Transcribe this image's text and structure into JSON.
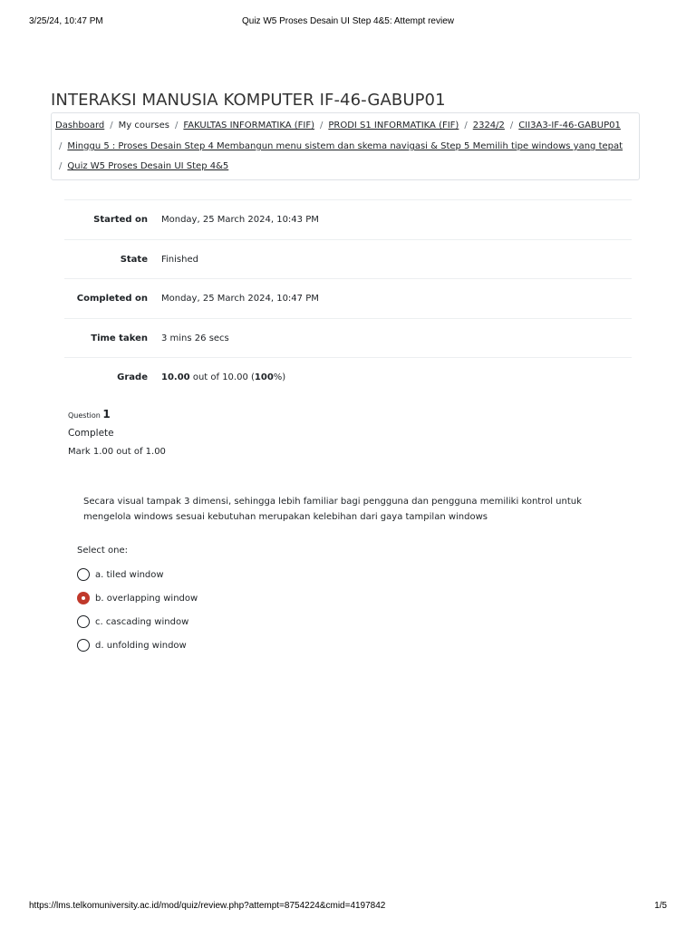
{
  "print_header": {
    "datetime": "3/25/24, 10:47 PM",
    "page_title": "Quiz W5 Proses Desain UI Step 4&5: Attempt review"
  },
  "course_title": "INTERAKSI MANUSIA KOMPUTER IF-46-GABUP01",
  "breadcrumb": {
    "items": [
      "Dashboard",
      "My courses",
      "FAKULTAS INFORMATIKA (FIF)",
      "PRODI S1 INFORMATIKA (FIF)",
      "2324/2",
      "CII3A3-IF-46-GABUP01",
      "Minggu 5 : Proses Desain Step 4 Membangun menu sistem dan skema navigasi & Step 5 Memilih tipe windows yang tepat",
      "Quiz W5 Proses Desain UI Step 4&5"
    ],
    "separator": "/"
  },
  "summary": {
    "started_label": "Started on",
    "started_value": "Monday, 25 March 2024, 10:43 PM",
    "state_label": "State",
    "state_value": "Finished",
    "completed_label": "Completed on",
    "completed_value": "Monday, 25 March 2024, 10:47 PM",
    "time_label": "Time taken",
    "time_value": "3 mins 26 secs",
    "grade_label": "Grade",
    "grade_score": "10.00",
    "grade_outof": " out of 10.00 (",
    "grade_percent": "100",
    "grade_close": "%)"
  },
  "question": {
    "label": "Question",
    "number": "1",
    "state": "Complete",
    "mark": "Mark 1.00 out of 1.00",
    "text": "Secara visual tampak 3 dimensi, sehingga lebih familiar bagi pengguna dan pengguna memiliki kontrol untuk mengelola windows sesuai kebutuhan merupakan kelebihan dari gaya tampilan windows",
    "prompt": "Select one:",
    "options": [
      {
        "label": "a. tiled window",
        "checked": false
      },
      {
        "label": "b. overlapping window",
        "checked": true
      },
      {
        "label": "c. cascading window",
        "checked": false
      },
      {
        "label": "d. unfolding window",
        "checked": false
      }
    ],
    "selected_color": "#c0392b"
  },
  "print_footer": {
    "url": "https://lms.telkomuniversity.ac.id/mod/quiz/review.php?attempt=8754224&cmid=4197842",
    "page": "1/5"
  }
}
